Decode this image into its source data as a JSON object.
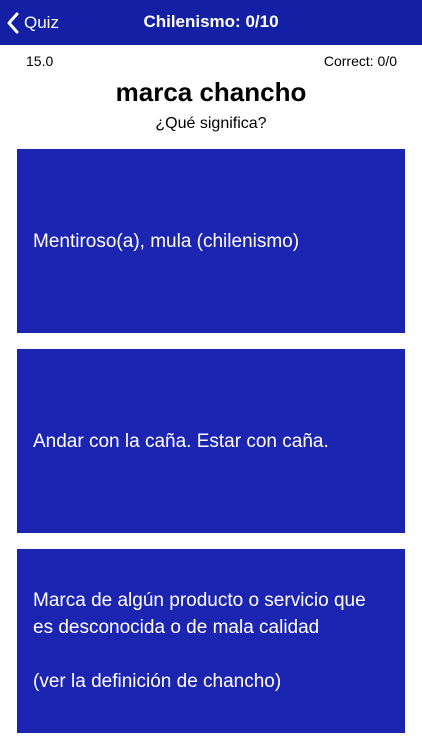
{
  "navbar": {
    "back_label": "Quiz",
    "title": "Chilenismo: 0/10"
  },
  "status": {
    "timer": "15.0",
    "score": "Correct: 0/0"
  },
  "question": {
    "term": "marca chancho",
    "prompt": "¿Qué significa?"
  },
  "options": [
    {
      "text": "Mentiroso(a), mula (chilenismo)"
    },
    {
      "text": "Andar con la caña. Estar con caña."
    },
    {
      "text": "Marca de algún producto o servicio que es desconocida o de mala calidad\n\n(ver la definición de chancho)"
    }
  ],
  "colors": {
    "navbar": "#1320a6",
    "option": "#1c24b2"
  },
  "icons": {
    "back": "chevron-left-icon"
  }
}
